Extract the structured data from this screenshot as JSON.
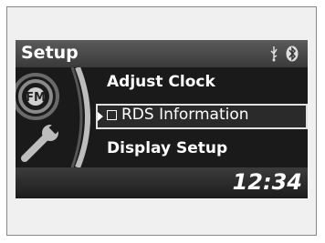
{
  "screen": {
    "title": "Setup",
    "status_icons": [
      "usb-icon",
      "bluetooth-icon"
    ],
    "side_icons": [
      "fm-radio-icon",
      "wrench-icon"
    ],
    "menu": [
      {
        "label": "Adjust Clock",
        "selected": false,
        "checkbox": false
      },
      {
        "label": "RDS Information",
        "selected": true,
        "checkbox": true,
        "checked": false
      },
      {
        "label": "Display Setup",
        "selected": false,
        "checkbox": false
      }
    ],
    "fm_label": "FM",
    "clock": "12:34"
  }
}
